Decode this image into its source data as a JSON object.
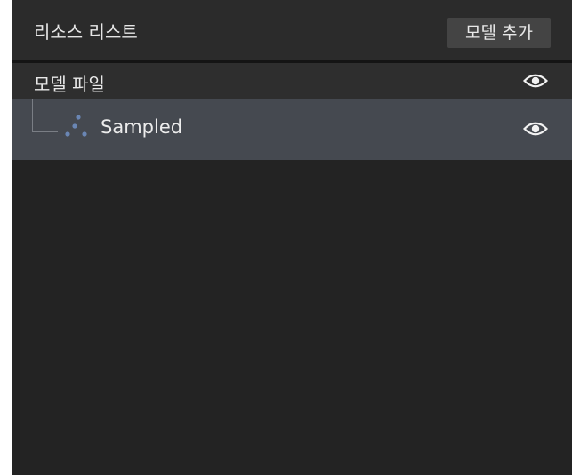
{
  "panel": {
    "title": "리소스 리스트",
    "add_button_label": "모델 추가"
  },
  "tree": {
    "group": {
      "label": "모델 파일",
      "visibility_icon": "eye-icon"
    },
    "items": [
      {
        "label": "Sampled",
        "type_icon": "point-cloud-icon",
        "visibility_icon": "eye-icon",
        "selected": true
      }
    ]
  },
  "colors": {
    "panel_bg": "#232323",
    "header_bg": "#2b2b2b",
    "group_row_bg": "#2e2e2e",
    "selected_row_bg": "#454950",
    "button_bg": "#444444",
    "text": "#e8e8e8",
    "point_cloud_icon": "#6a86b4"
  }
}
